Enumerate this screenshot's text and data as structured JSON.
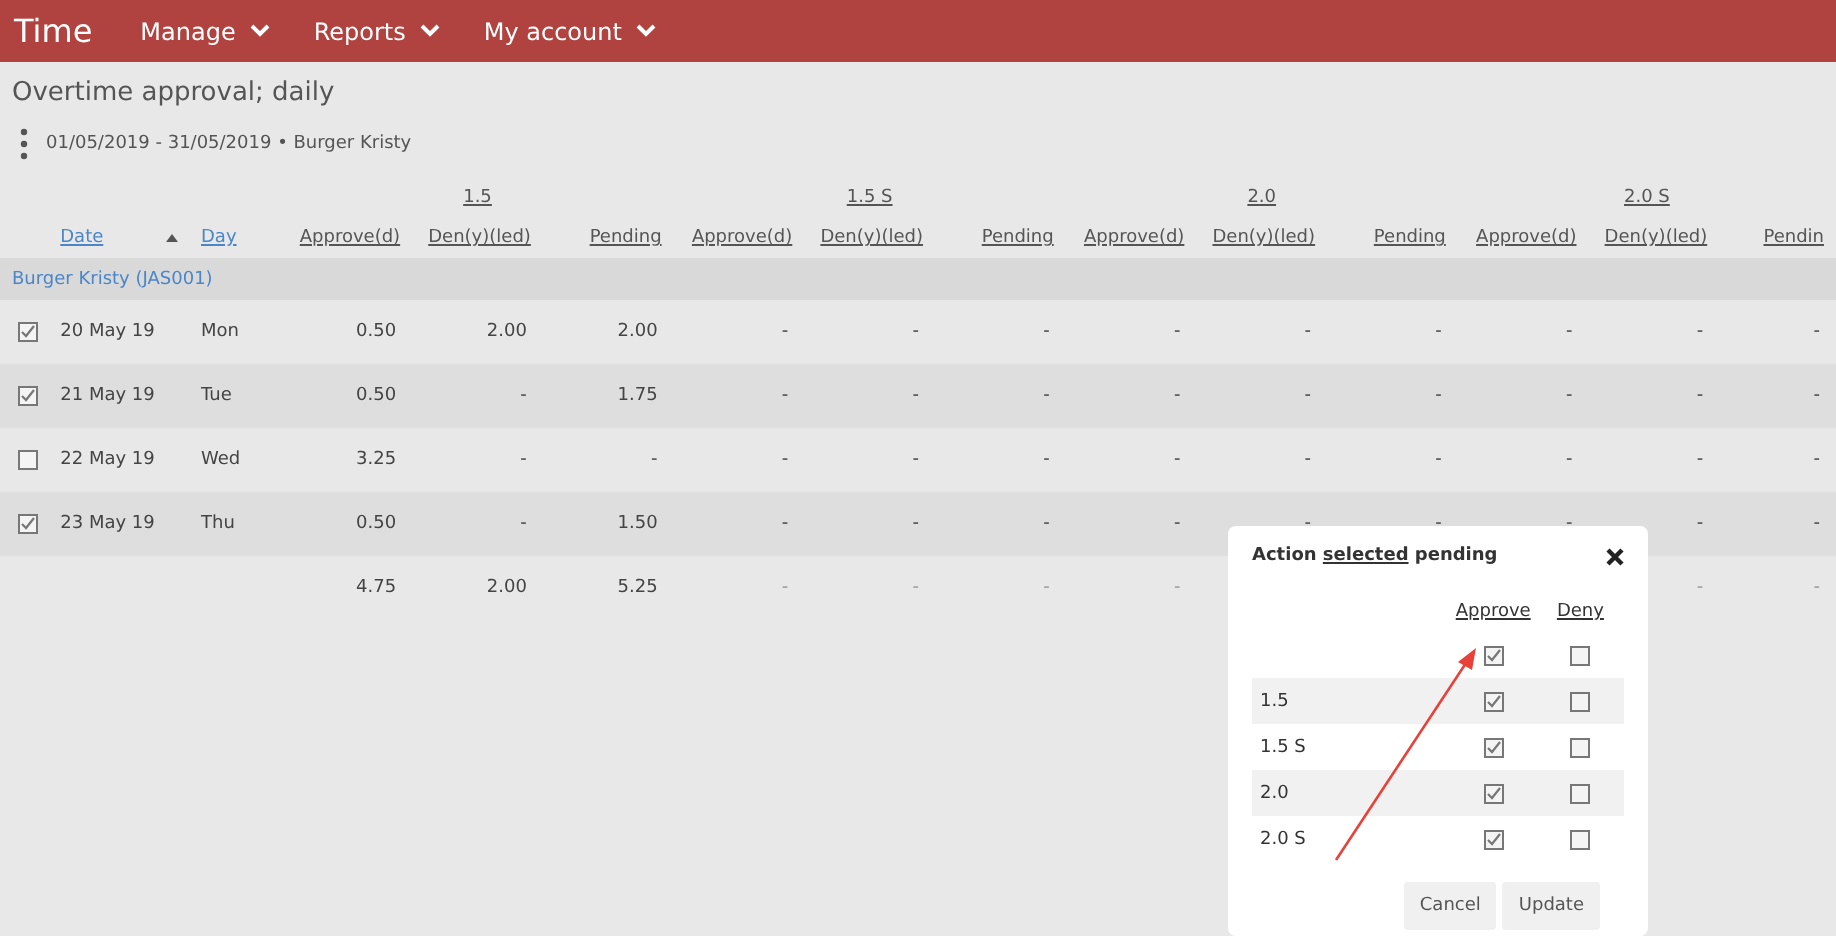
{
  "app": {
    "title": "Time",
    "menu": [
      {
        "label": "Manage"
      },
      {
        "label": "Reports"
      },
      {
        "label": "My account"
      }
    ]
  },
  "page": {
    "title": "Overtime approval; daily",
    "filter": "01/05/2019 - 31/05/2019 • Burger Kristy"
  },
  "table": {
    "groups": [
      "1.5",
      "1.5 S",
      "2.0",
      "2.0 S"
    ],
    "columns": [
      "Date",
      "Day",
      "Approve(d)",
      "Den(y)(led)",
      "Pending",
      "Approve(d)",
      "Den(y)(led)",
      "Pending",
      "Approve(d)",
      "Den(y)(led)",
      "Pending",
      "Approve(d)",
      "Den(y)(led)",
      "Pendin"
    ],
    "employee": "Burger Kristy (JAS001)",
    "rows": [
      {
        "selected": true,
        "date": "20 May 19",
        "day": "Mon",
        "values": [
          "0.50",
          "2.00",
          "2.00",
          "-",
          "-",
          "-",
          "-",
          "-",
          "-",
          "-",
          "-",
          "-"
        ]
      },
      {
        "selected": true,
        "date": "21 May 19",
        "day": "Tue",
        "values": [
          "0.50",
          "-",
          "1.75",
          "-",
          "-",
          "-",
          "-",
          "-",
          "-",
          "-",
          "-",
          "-"
        ]
      },
      {
        "selected": false,
        "date": "22 May 19",
        "day": "Wed",
        "values": [
          "3.25",
          "-",
          "-",
          "-",
          "-",
          "-",
          "-",
          "-",
          "-",
          "-",
          "-",
          "-"
        ]
      },
      {
        "selected": true,
        "date": "23 May 19",
        "day": "Thu",
        "values": [
          "0.50",
          "-",
          "1.50",
          "-",
          "-",
          "-",
          "-",
          "-",
          "-",
          "-",
          "-",
          "-"
        ]
      }
    ],
    "totals": [
      "4.75",
      "2.00",
      "5.25",
      "-",
      "-",
      "-",
      "-"
    ],
    "totals_right_of_dialog": [
      "-",
      "-"
    ]
  },
  "dialog": {
    "title": [
      {
        "text": "Action ",
        "link": false
      },
      {
        "text": "selected",
        "link": true
      },
      {
        "text": " pending",
        "link": false
      }
    ],
    "columns": [
      "Approve",
      "Deny"
    ],
    "rows": [
      {
        "approve": true,
        "deny": false
      },
      {
        "label": "1.5",
        "approve": true,
        "deny": false
      },
      {
        "label": "1.5 S",
        "approve": true,
        "deny": false
      },
      {
        "label": "2.0",
        "approve": true,
        "deny": false
      },
      {
        "label": "2.0 S",
        "approve": true,
        "deny": false
      }
    ],
    "buttons": [
      "Cancel",
      "Update"
    ]
  }
}
